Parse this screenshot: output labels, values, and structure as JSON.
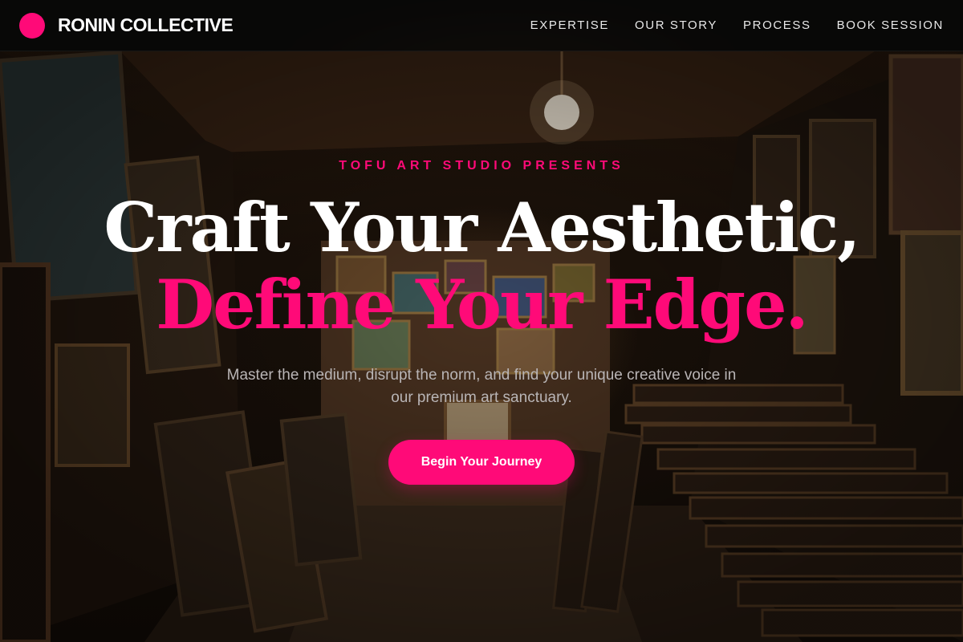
{
  "nav": {
    "brand": "RONIN COLLECTIVE",
    "links": [
      "EXPERTISE",
      "OUR STORY",
      "PROCESS",
      "BOOK SESSION"
    ]
  },
  "hero": {
    "eyebrow": "TOFU ART STUDIO PRESENTS",
    "headline_line1": "Craft Your Aesthetic,",
    "headline_line2": "Define Your Edge.",
    "subtext": "Master the medium, disrupt the norm, and find your unique creative voice in our premium art sanctuary.",
    "cta_label": "Begin Your Journey"
  },
  "colors": {
    "accent": "#ff0a78",
    "nav_background": "#080808",
    "headline_white": "#ffffff",
    "subtext_gray": "#b9b5b6"
  }
}
